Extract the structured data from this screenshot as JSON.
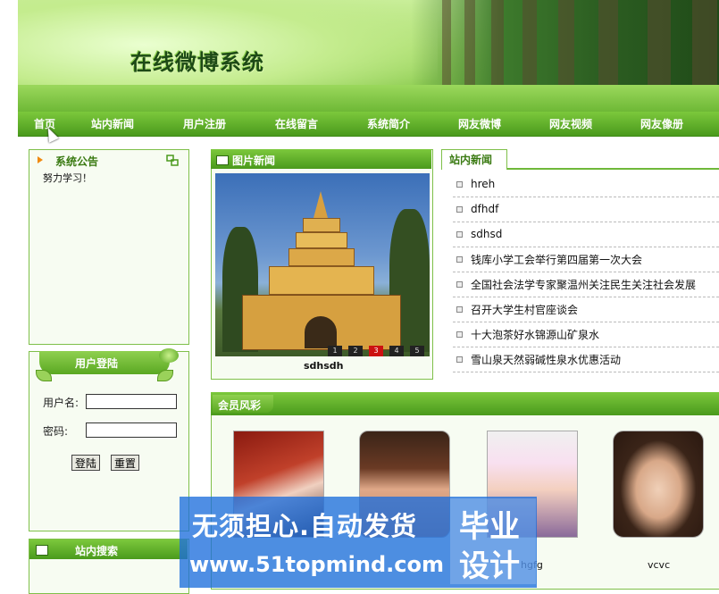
{
  "header": {
    "site_title": "在线微博系统"
  },
  "nav": {
    "items": [
      "首页",
      "站内新闻",
      "用户注册",
      "在线留言",
      "系统简介",
      "网友微博",
      "网友视频",
      "网友像册"
    ]
  },
  "notice": {
    "title": "系统公告",
    "text": "努力学习！"
  },
  "login": {
    "title": "用户登陆",
    "username_label": "用户名:",
    "password_label": "密码:",
    "username_value": "",
    "password_value": "",
    "login_button": "登陆",
    "reset_button": "重置"
  },
  "search": {
    "title": "站内搜索"
  },
  "picture_news": {
    "title": "图片新闻",
    "caption": "sdhsdh",
    "pages": [
      "1",
      "2",
      "3",
      "4",
      "5"
    ],
    "active_page": "3"
  },
  "site_news": {
    "title": "站内新闻",
    "items": [
      "hreh",
      "dfhdf",
      "sdhsd",
      "钱库小学工会举行第四届第一次大会",
      "全国社会法学专家聚温州关注民生关注社会发展",
      "召开大学生村官座谈会",
      "十大泡茶好水锦源山矿泉水",
      "雪山泉天然弱碱性泉水优惠活动"
    ]
  },
  "members": {
    "title": "会员风彩",
    "names": [
      "",
      "",
      "hgfg",
      "vcvc"
    ]
  },
  "watermark": {
    "line1": "无须担心.自动发货",
    "line2": "www.51topmind.com",
    "badge_line1": "毕业",
    "badge_line2": "设计"
  },
  "colors": {
    "accent": "#5aa822",
    "title_green": "#3a7a12",
    "watermark_blue": "#1e6edc"
  }
}
